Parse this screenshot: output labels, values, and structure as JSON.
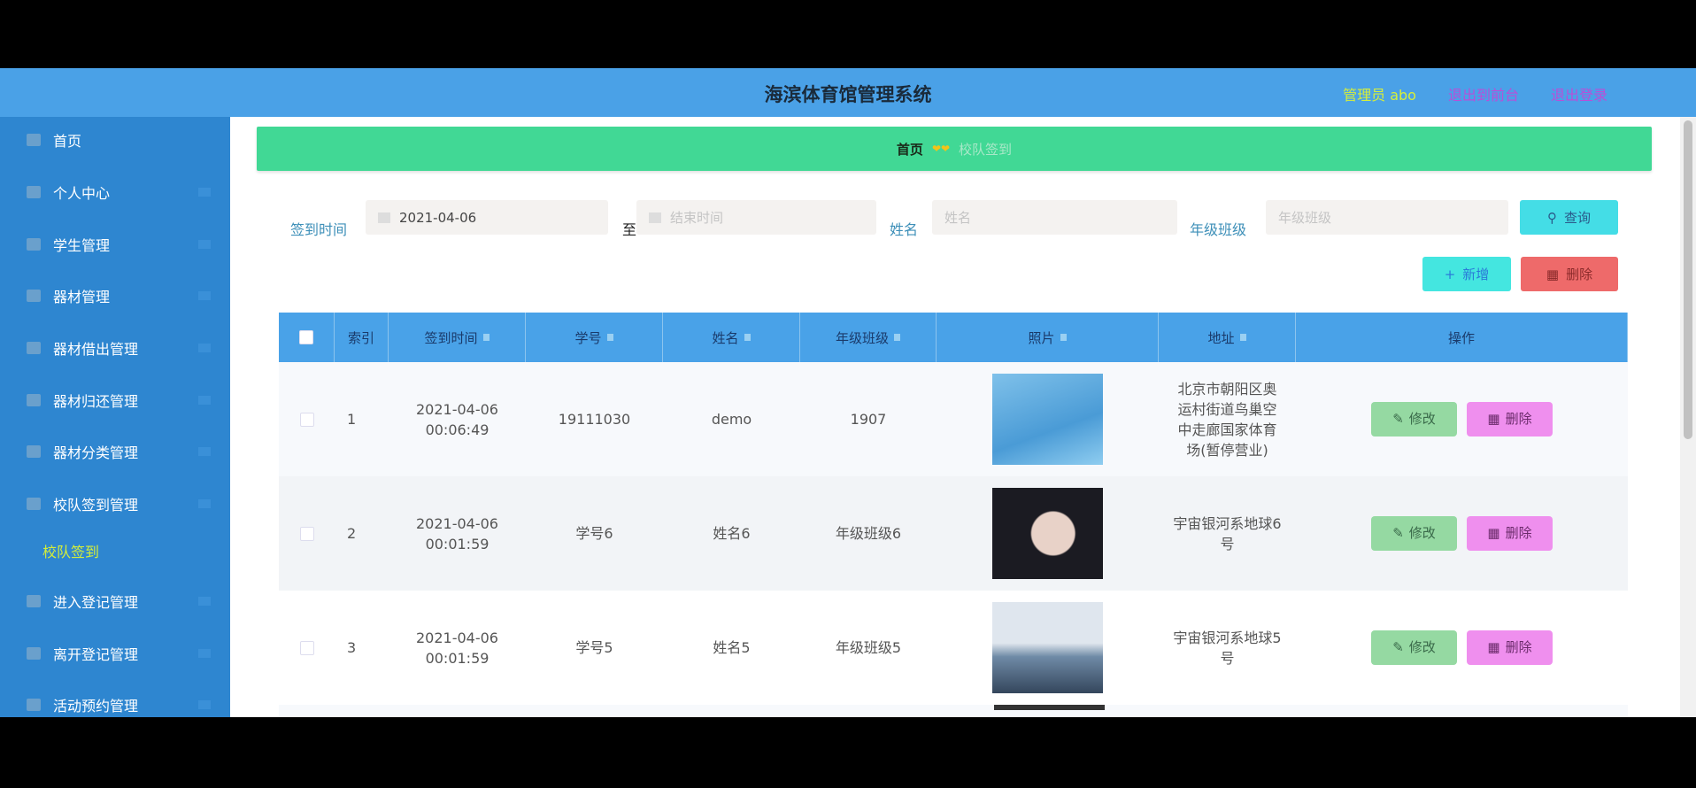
{
  "header": {
    "title": "海滨体育馆管理系统",
    "user": "管理员 abo",
    "front_link": "退出到前台",
    "logout": "退出登录"
  },
  "sidebar": {
    "items": [
      "首页",
      "个人中心",
      "学生管理",
      "器材管理",
      "器材借出管理",
      "器材归还管理",
      "器材分类管理",
      "校队签到管理",
      "进入登记管理",
      "离开登记管理",
      "活动预约管理"
    ],
    "sub_item": "校队签到"
  },
  "breadcrumb": {
    "home": "首页",
    "separator": "❤❤",
    "current": "校队签到"
  },
  "search": {
    "time_label": "签到时间",
    "start_value": "2021-04-06",
    "to": "至",
    "end_placeholder": "结束时间",
    "name_label": "姓名",
    "name_placeholder": "姓名",
    "class_label": "年级班级",
    "class_placeholder": "年级班级",
    "query": "查询"
  },
  "toolbar": {
    "add": "新增",
    "delete": "删除"
  },
  "table": {
    "columns": [
      "索引",
      "签到时间",
      "学号",
      "姓名",
      "年级班级",
      "照片",
      "地址",
      "操作"
    ],
    "rows": [
      {
        "index": "1",
        "time": "2021-04-06 00:06:49",
        "sid": "19111030",
        "name": "demo",
        "class": "1907",
        "address": "北京市朝阳区奥运村街道鸟巢空中走廊国家体育场(暂停营业)"
      },
      {
        "index": "2",
        "time": "2021-04-06 00:01:59",
        "sid": "学号6",
        "name": "姓名6",
        "class": "年级班级6",
        "address": "宇宙银河系地球6号"
      },
      {
        "index": "3",
        "time": "2021-04-06 00:01:59",
        "sid": "学号5",
        "name": "姓名5",
        "class": "年级班级5",
        "address": "宇宙银河系地球5号"
      }
    ],
    "edit": "修改",
    "delete": "删除"
  }
}
